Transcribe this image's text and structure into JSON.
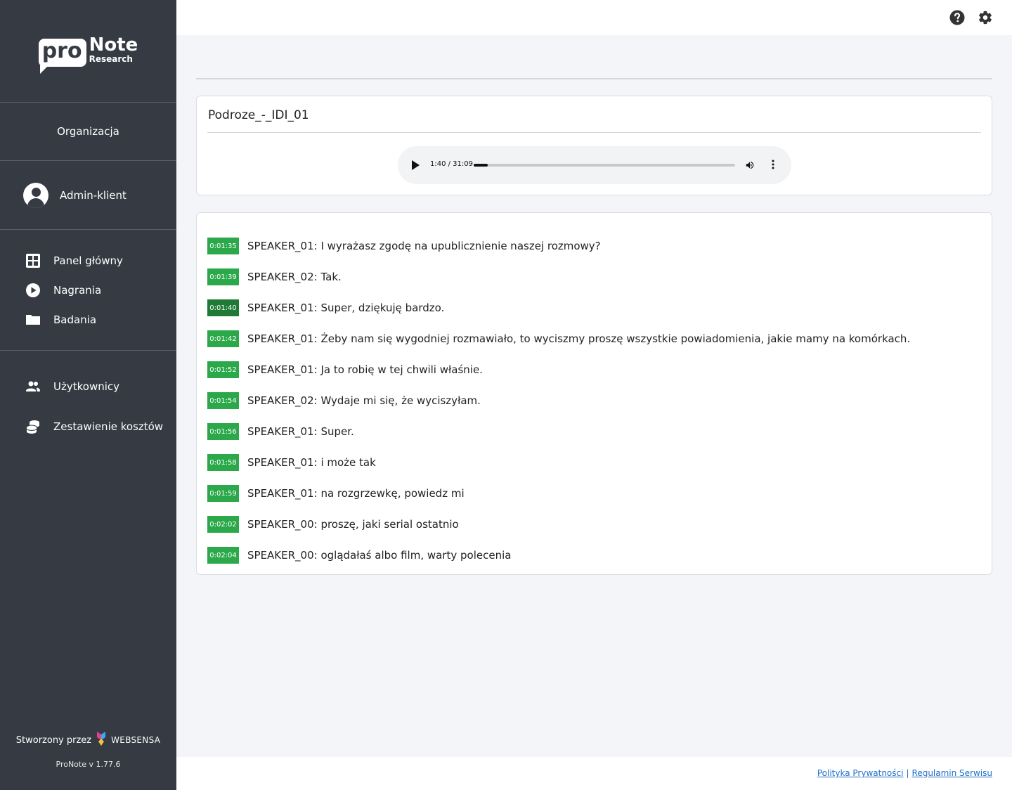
{
  "brand": {
    "logo_pro": "pro",
    "logo_note": "Note",
    "logo_research": "Research"
  },
  "sidebar": {
    "organization_label": "Organizacja",
    "user_name": "Admin-klient",
    "nav_main": [
      {
        "label": "Panel główny",
        "icon": "grid-icon"
      },
      {
        "label": "Nagrania",
        "icon": "play-circle-icon"
      },
      {
        "label": "Badania",
        "icon": "folder-icon"
      }
    ],
    "nav_admin": [
      {
        "label": "Użytkownicy",
        "icon": "users-icon"
      },
      {
        "label": "Zestawienie kosztów",
        "icon": "coins-icon"
      }
    ],
    "footer": {
      "created_by": "Stworzony przez",
      "company": "WEBSENSA",
      "version": "ProNote v 1.77.6"
    }
  },
  "topbar": {
    "help_icon": "help-icon",
    "settings_icon": "gear-icon"
  },
  "recording": {
    "title": "Podroze_-_IDI_01",
    "player": {
      "time": "1:40 / 31:09",
      "progress": 0.054
    }
  },
  "transcript": [
    {
      "time": "0:01:35",
      "text": "SPEAKER_01: I wyrażasz zgodę na upublicznienie naszej rozmowy?",
      "active": false
    },
    {
      "time": "0:01:39",
      "text": "SPEAKER_02: Tak.",
      "active": false
    },
    {
      "time": "0:01:40",
      "text": "SPEAKER_01: Super, dziękuję bardzo.",
      "active": true
    },
    {
      "time": "0:01:42",
      "text": "SPEAKER_01: Żeby nam się wygodniej rozmawiało, to wyciszmy proszę wszystkie powiadomienia, jakie mamy na komórkach.",
      "active": false
    },
    {
      "time": "0:01:52",
      "text": "SPEAKER_01: Ja to robię w tej chwili właśnie.",
      "active": false
    },
    {
      "time": "0:01:54",
      "text": "SPEAKER_02: Wydaje mi się, że wyciszyłam.",
      "active": false
    },
    {
      "time": "0:01:56",
      "text": "SPEAKER_01: Super.",
      "active": false
    },
    {
      "time": "0:01:58",
      "text": "SPEAKER_01: i może tak",
      "active": false
    },
    {
      "time": "0:01:59",
      "text": "SPEAKER_01: na rozgrzewkę, powiedz mi",
      "active": false
    },
    {
      "time": "0:02:02",
      "text": "SPEAKER_00: proszę, jaki serial ostatnio",
      "active": false
    },
    {
      "time": "0:02:04",
      "text": "SPEAKER_00: oglądałaś albo film, warty polecenia",
      "active": false
    }
  ],
  "footer": {
    "privacy": "Polityka Prywatności",
    "separator": "|",
    "terms": "Regulamin Serwisu"
  },
  "colors": {
    "sidebar": "#353a43",
    "timestamp": "#2ba84a",
    "timestamp_active": "#1f7a36",
    "link": "#1f6fc9"
  }
}
